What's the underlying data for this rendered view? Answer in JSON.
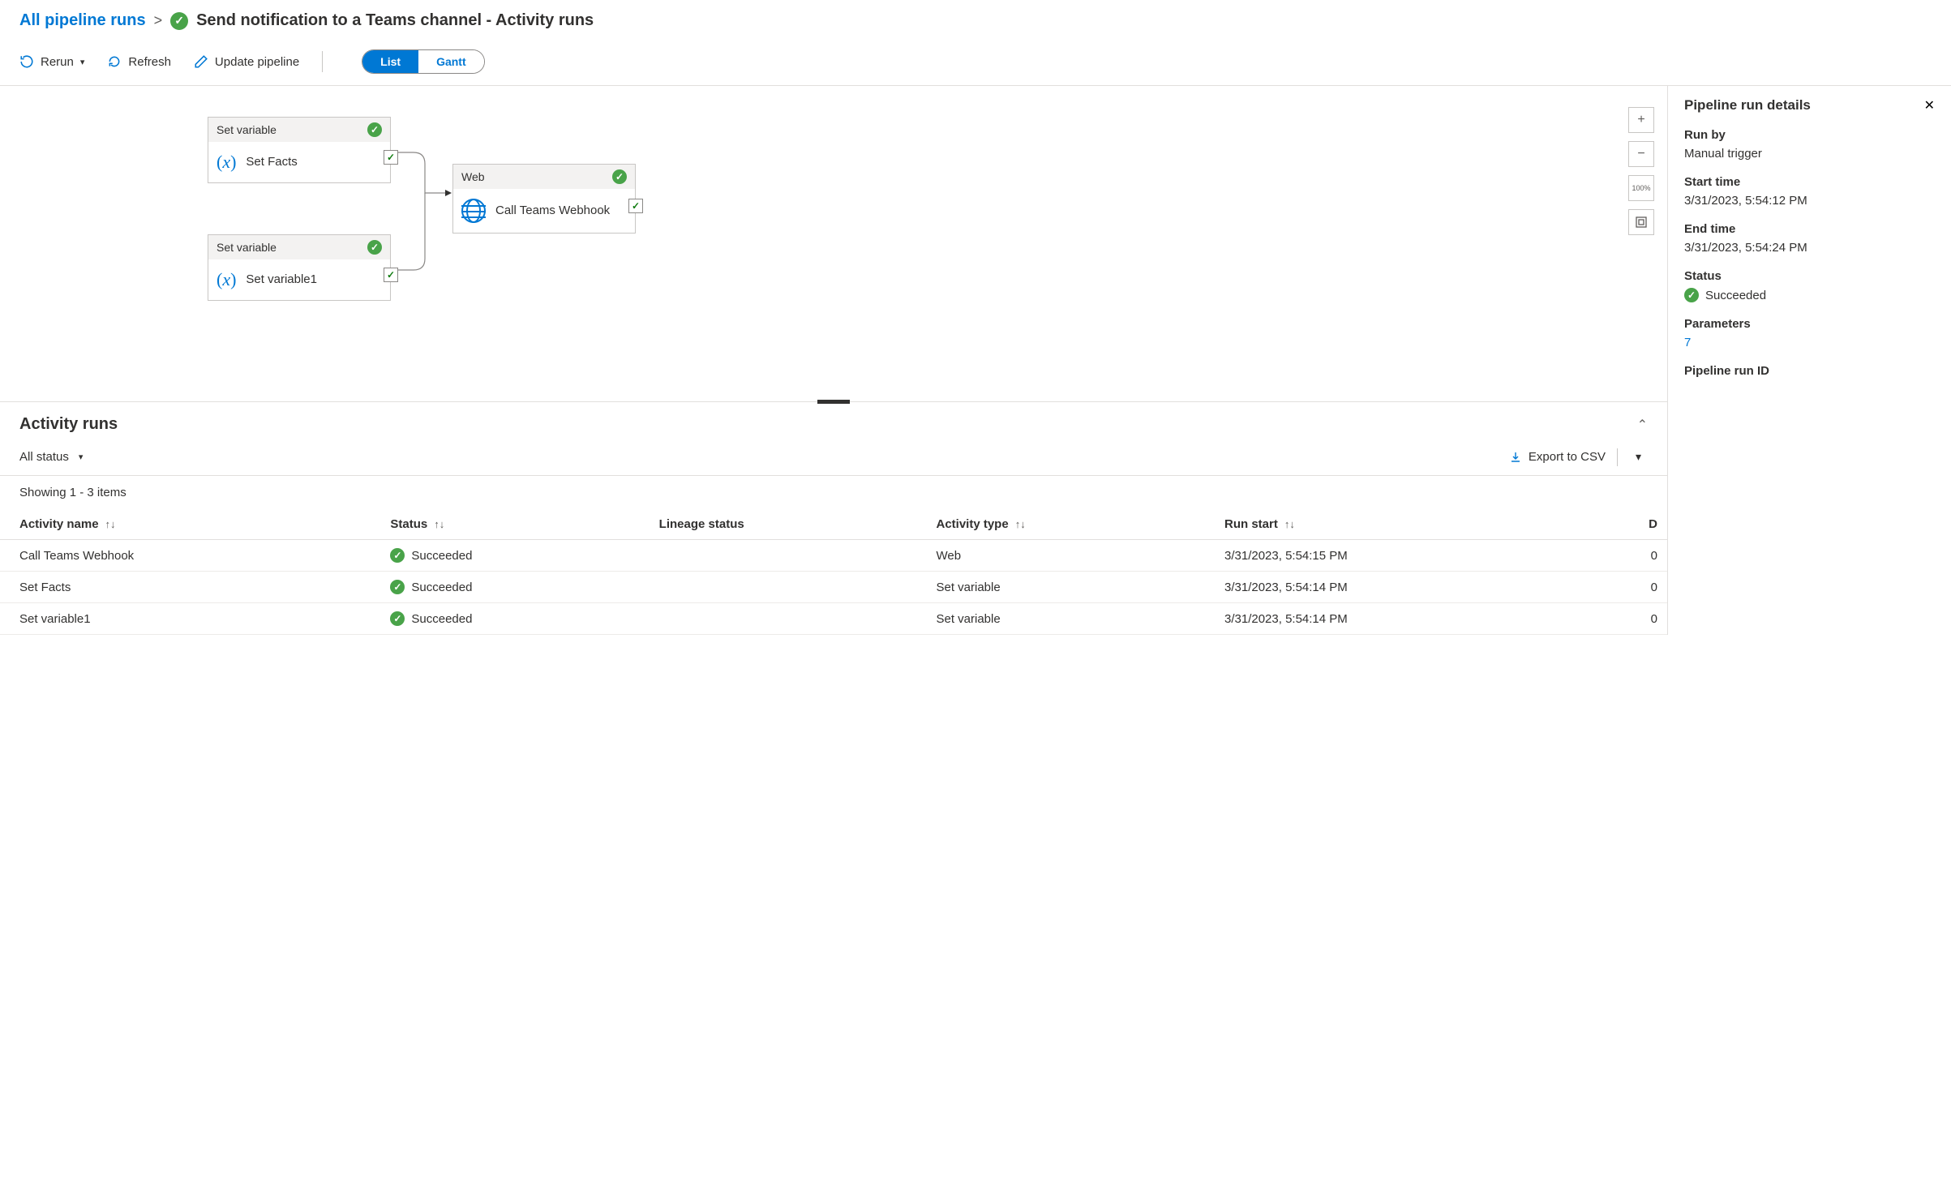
{
  "breadcrumb": {
    "all_runs": "All pipeline runs",
    "title": "Send notification to a Teams channel - Activity runs"
  },
  "toolbar": {
    "rerun": "Rerun",
    "refresh": "Refresh",
    "update": "Update pipeline",
    "list": "List",
    "gantt": "Gantt"
  },
  "nodes": {
    "n1": {
      "type": "Set variable",
      "name": "Set Facts"
    },
    "n2": {
      "type": "Set variable",
      "name": "Set variable1"
    },
    "n3": {
      "type": "Web",
      "name": "Call Teams Webhook"
    }
  },
  "canvas_controls": {
    "zoom_label": "100%"
  },
  "activity_runs": {
    "title": "Activity runs",
    "filter": "All status",
    "export": "Export to CSV",
    "showing": "Showing 1 - 3 items",
    "columns": {
      "name": "Activity name",
      "status": "Status",
      "lineage": "Lineage status",
      "type": "Activity type",
      "start": "Run start",
      "duration": "D"
    },
    "rows": [
      {
        "name": "Call Teams Webhook",
        "status": "Succeeded",
        "type": "Web",
        "start": "3/31/2023, 5:54:15 PM",
        "d": "0"
      },
      {
        "name": "Set Facts",
        "status": "Succeeded",
        "type": "Set variable",
        "start": "3/31/2023, 5:54:14 PM",
        "d": "0"
      },
      {
        "name": "Set variable1",
        "status": "Succeeded",
        "type": "Set variable",
        "start": "3/31/2023, 5:54:14 PM",
        "d": "0"
      }
    ]
  },
  "details": {
    "title": "Pipeline run details",
    "run_by_label": "Run by",
    "run_by": "Manual trigger",
    "start_label": "Start time",
    "start": "3/31/2023, 5:54:12 PM",
    "end_label": "End time",
    "end": "3/31/2023, 5:54:24 PM",
    "status_label": "Status",
    "status": "Succeeded",
    "params_label": "Parameters",
    "params": "7",
    "runid_label": "Pipeline run ID"
  }
}
